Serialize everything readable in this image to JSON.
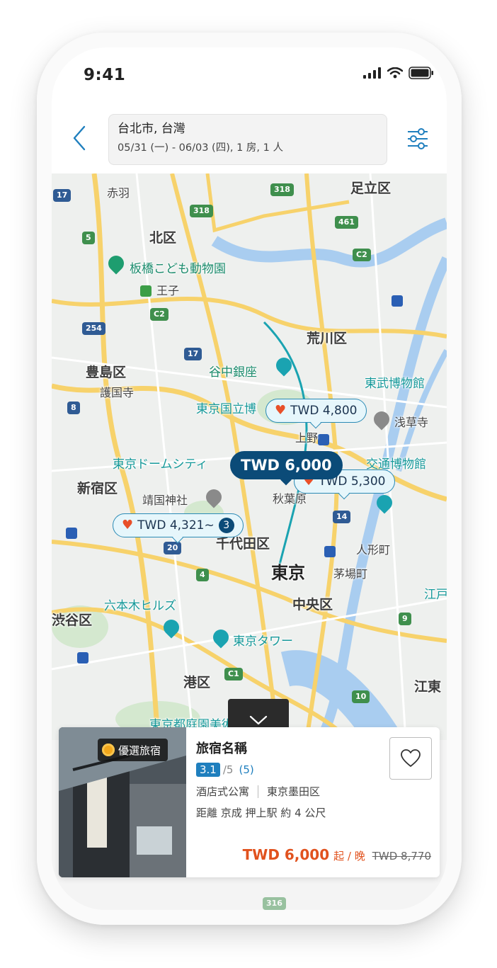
{
  "status_bar": {
    "time": "9:41"
  },
  "search": {
    "location": "台北市, 台灣",
    "details": "05/31 (一) - 06/03 (四), 1 房, 1 人"
  },
  "map": {
    "labels": {
      "adachi": "足立区",
      "akabane": "赤羽",
      "kita": "北区",
      "itabashi_zoo": "板橋こども動物園",
      "oji": "王子",
      "arakawa": "荒川区",
      "toshima": "豊島区",
      "gokokuji": "護国寺",
      "yanaka": "谷中銀座",
      "tobu_museum": "東武博物館",
      "national_museum": "東京国立博",
      "asakusa": "浅草寺",
      "ueno": "上野",
      "tokyo_dome": "東京ドームシティ",
      "transport_museum": "交通博物館",
      "shinjuku": "新宿区",
      "yasukuni": "靖国神社",
      "akihabara": "秋葉原",
      "chiyoda": "千代田区",
      "ningyocho": "人形町",
      "tokyo": "東京",
      "kayabacho": "茅場町",
      "roppongi": "六本木ヒルズ",
      "chuo": "中央区",
      "koto_edge": "江戸",
      "shibuya": "渋谷区",
      "tokyo_tower": "東京タワー",
      "minato": "港区",
      "koto": "江東",
      "tokyo_metro_bldg": "東京都庭園美術館"
    },
    "shields": [
      "318",
      "318",
      "461",
      "17",
      "5",
      "C2",
      "C2",
      "254",
      "17",
      "8",
      "20",
      "4",
      "14",
      "9",
      "C1",
      "10",
      "316"
    ],
    "pins": [
      {
        "label": "TWD 4,800",
        "favorite": true
      },
      {
        "label": "TWD 6,000",
        "selected": true
      },
      {
        "label": "TWD 5,300",
        "favorite": true
      },
      {
        "label": "TWD 4,321~",
        "favorite": true,
        "count": "3"
      }
    ]
  },
  "card": {
    "badge": "優選旅宿",
    "name": "旅宿名稱",
    "score": "3.1",
    "out_of": "/5",
    "reviews": "(5)",
    "type": "酒店式公寓",
    "area": "東京墨田区",
    "distance": "距離 京成 押上駅 約 4 公尺",
    "price": "TWD 6,000",
    "per_night": "起 / 晚",
    "original_price": "TWD 8,770"
  },
  "icons": {
    "back": "chevron-left-icon",
    "filter": "sliders-icon",
    "collapse": "chevron-down-icon",
    "favorite": "heart-outline-icon"
  },
  "colors": {
    "accent": "#1f7fbe",
    "selected_pin": "#0b4b78",
    "price": "#e1521e",
    "heart": "#e8502a"
  }
}
